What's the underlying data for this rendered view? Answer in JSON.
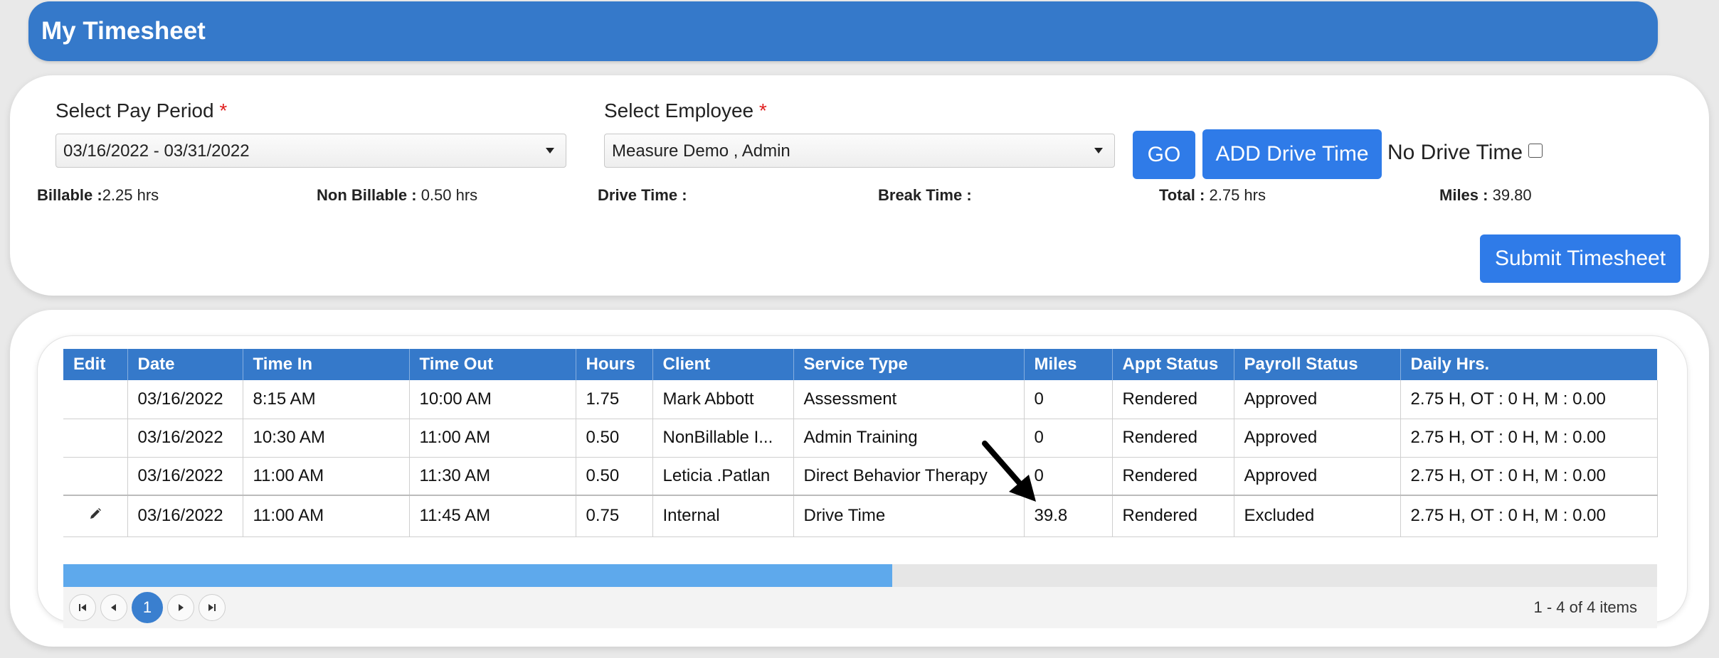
{
  "header": {
    "title": "My Timesheet"
  },
  "filters": {
    "pay_period_label": "Select Pay Period",
    "pay_period_value": "03/16/2022 - 03/31/2022",
    "employee_label": "Select Employee",
    "employee_value": "Measure Demo , Admin",
    "required_mark": "*",
    "go_label": "GO",
    "add_drive_label": "ADD Drive Time",
    "no_drive_label": "No Drive Time",
    "submit_label": "Submit Timesheet"
  },
  "summary": {
    "billable_label": "Billable :",
    "billable_value": "2.25 hrs",
    "nonbillable_label": "Non Billable :",
    "nonbillable_value": "0.50 hrs",
    "drive_label": "Drive Time :",
    "drive_value": "",
    "break_label": "Break Time :",
    "break_value": "",
    "total_label": "Total :",
    "total_value": "2.75 hrs",
    "miles_label": "Miles :",
    "miles_value": "39.80"
  },
  "table": {
    "columns": [
      "Edit",
      "Date",
      "Time In",
      "Time Out",
      "Hours",
      "Client",
      "Service Type",
      "Miles",
      "Appt Status",
      "Payroll Status",
      "Daily Hrs."
    ],
    "rows": [
      [
        "",
        "03/16/2022",
        "8:15 AM",
        "10:00 AM",
        "1.75",
        "Mark Abbott",
        "Assessment",
        "0",
        "Rendered",
        "Approved",
        "2.75 H, OT : 0 H, M : 0.00"
      ],
      [
        "",
        "03/16/2022",
        "10:30 AM",
        "11:00 AM",
        "0.50",
        "NonBillable I...",
        "Admin Training",
        "0",
        "Rendered",
        "Approved",
        "2.75 H, OT : 0 H, M : 0.00"
      ],
      [
        "",
        "03/16/2022",
        "11:00 AM",
        "11:30 AM",
        "0.50",
        "Leticia .Patlan",
        "Direct Behavior Therapy",
        "0",
        "Rendered",
        "Approved",
        "2.75 H, OT : 0 H, M : 0.00"
      ],
      [
        "pencil-icon",
        "03/16/2022",
        "11:00 AM",
        "11:45 AM",
        "0.75",
        "Internal",
        "Drive Time",
        "39.8",
        "Rendered",
        "Excluded",
        "2.75 H, OT : 0 H, M : 0.00"
      ]
    ]
  },
  "pager": {
    "current_page": "1",
    "info": "1 - 4 of 4 items"
  },
  "scroll_fraction": 0.52,
  "colors": {
    "accent": "#3579ca",
    "button": "#2f7be8"
  }
}
